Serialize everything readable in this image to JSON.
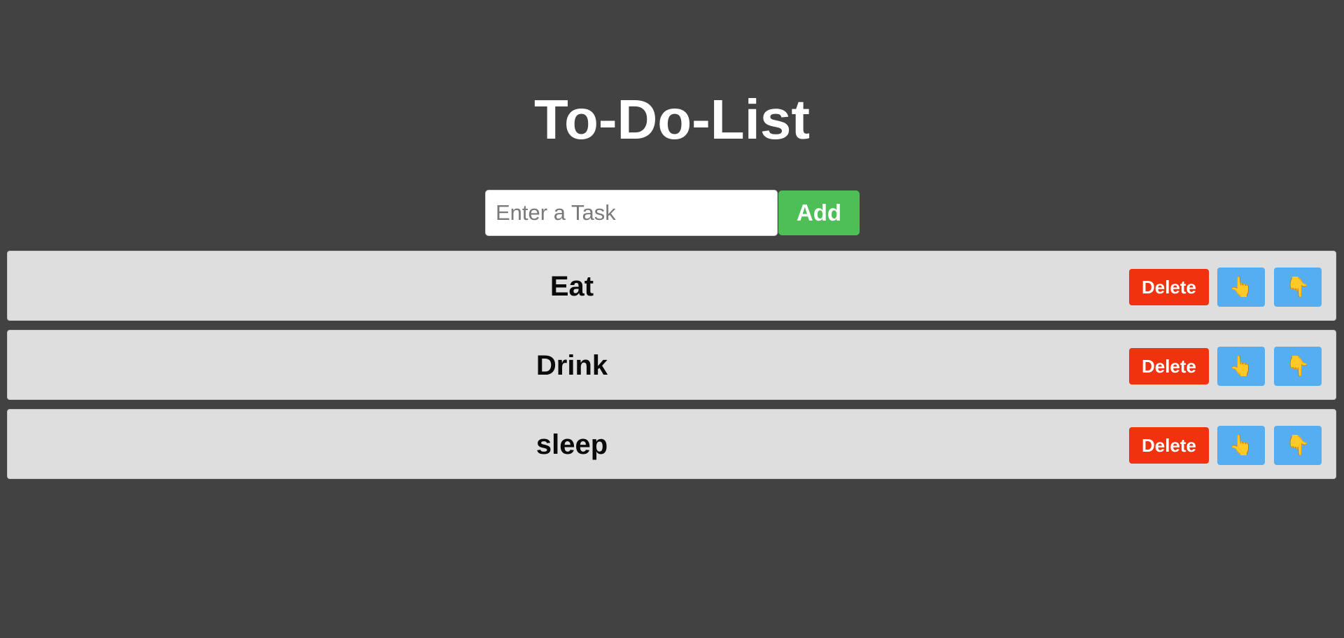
{
  "header": {
    "title": "To-Do-List"
  },
  "add_form": {
    "placeholder": "Enter a Task",
    "value": "",
    "add_label": "Add"
  },
  "tasks": [
    {
      "text": "Eat",
      "delete_label": "Delete",
      "up_icon": "👆",
      "down_icon": "👇"
    },
    {
      "text": "Drink",
      "delete_label": "Delete",
      "up_icon": "👆",
      "down_icon": "👇"
    },
    {
      "text": "sleep",
      "delete_label": "Delete",
      "up_icon": "👆",
      "down_icon": "👇"
    }
  ],
  "icons": {
    "move_up": "pointing-up-hand-icon",
    "move_down": "pointing-down-hand-icon"
  },
  "colors": {
    "background": "#424242",
    "add_button": "#4dbf56",
    "delete_button": "#f0320e",
    "move_button": "#55adf2",
    "task_row": "#dedede"
  }
}
